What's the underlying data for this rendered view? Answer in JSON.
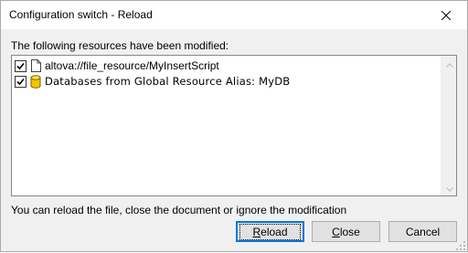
{
  "window": {
    "title": "Configuration switch - Reload"
  },
  "dialog": {
    "prompt": "The following resources have been modified:",
    "info": "You can reload the file, close the document or ignore the modification"
  },
  "resources": [
    {
      "label": "altova://file_resource/MyInsertScript",
      "checked": true,
      "icon": "file-icon"
    },
    {
      "label": "Databases from Global Resource Alias: MyDB",
      "checked": true,
      "icon": "database-icon"
    }
  ],
  "buttons": {
    "reload": {
      "mnemonic": "R",
      "rest": "eload"
    },
    "close": {
      "mnemonic": "C",
      "rest": "lose"
    },
    "cancel": "Cancel"
  },
  "colors": {
    "focus_border": "#0078d7",
    "database_icon": "#f2c500"
  }
}
